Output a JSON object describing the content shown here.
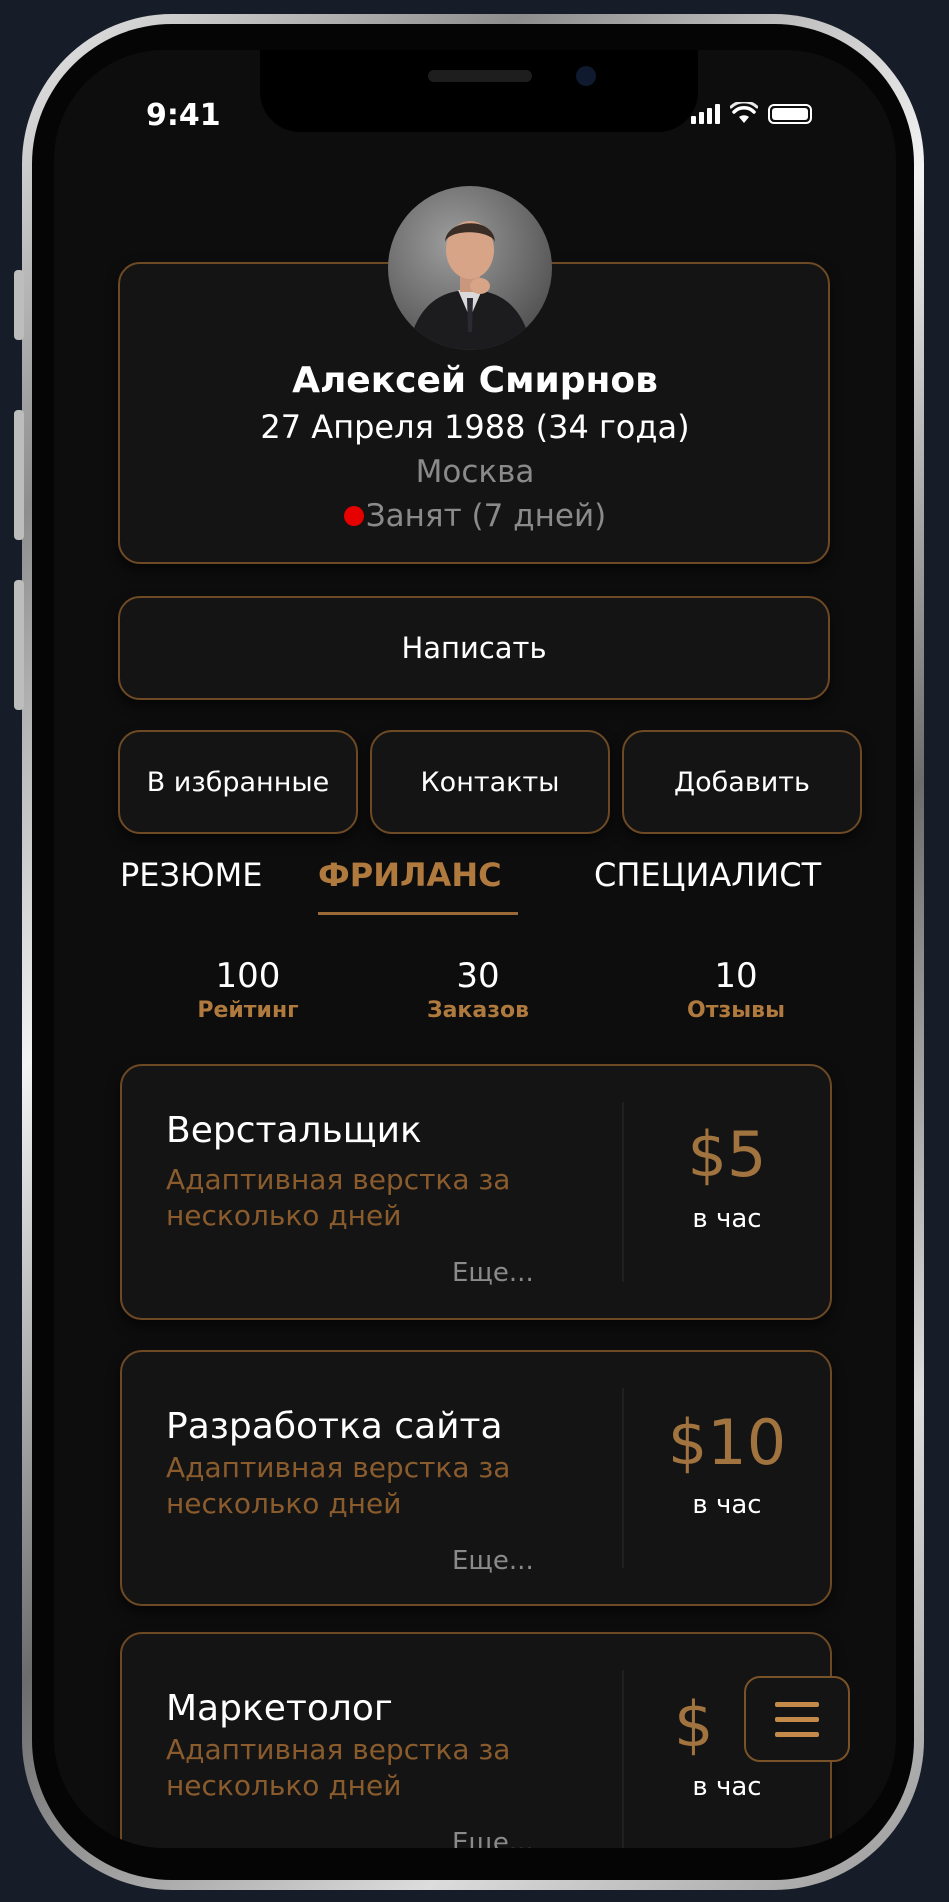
{
  "status_bar": {
    "time": "9:41"
  },
  "profile": {
    "name": "Алексей Смирнов",
    "birth": "27 Апреля 1988 (34 года)",
    "city": "Москва",
    "status": "Занят (7 дней)",
    "status_color": "#e60000"
  },
  "actions": {
    "write": "Написать",
    "favorites": "В избранные",
    "contacts": "Контакты",
    "add": "Добавить"
  },
  "tabs": [
    {
      "label": "РЕЗЮМЕ",
      "active": false
    },
    {
      "label": "ФРИЛАНС",
      "active": true
    },
    {
      "label": "СПЕЦИАЛИСТ",
      "active": false
    }
  ],
  "stats": [
    {
      "value": "100",
      "label": "Рейтинг"
    },
    {
      "value": "30",
      "label": "Заказов"
    },
    {
      "value": "10",
      "label": "Отзывы"
    }
  ],
  "services": [
    {
      "title": "Верстальщик",
      "desc": "Адаптивная верстка за несколько дней",
      "more": "Еще...",
      "price": "$5",
      "unit": "в час"
    },
    {
      "title": "Разработка сайта",
      "desc": "Адаптивная верстка за несколько дней",
      "more": "Еще...",
      "price": "$10",
      "unit": "в час"
    },
    {
      "title": "Маркетолог",
      "desc": "Адаптивная верстка за несколько дней",
      "more": "Еще...",
      "price": "$",
      "unit": "в час"
    }
  ],
  "colors": {
    "accent": "#b07a3e",
    "border": "#6d4a24",
    "background": "#0d0d0d"
  },
  "icons": {
    "menu": "hamburger-menu-icon"
  }
}
